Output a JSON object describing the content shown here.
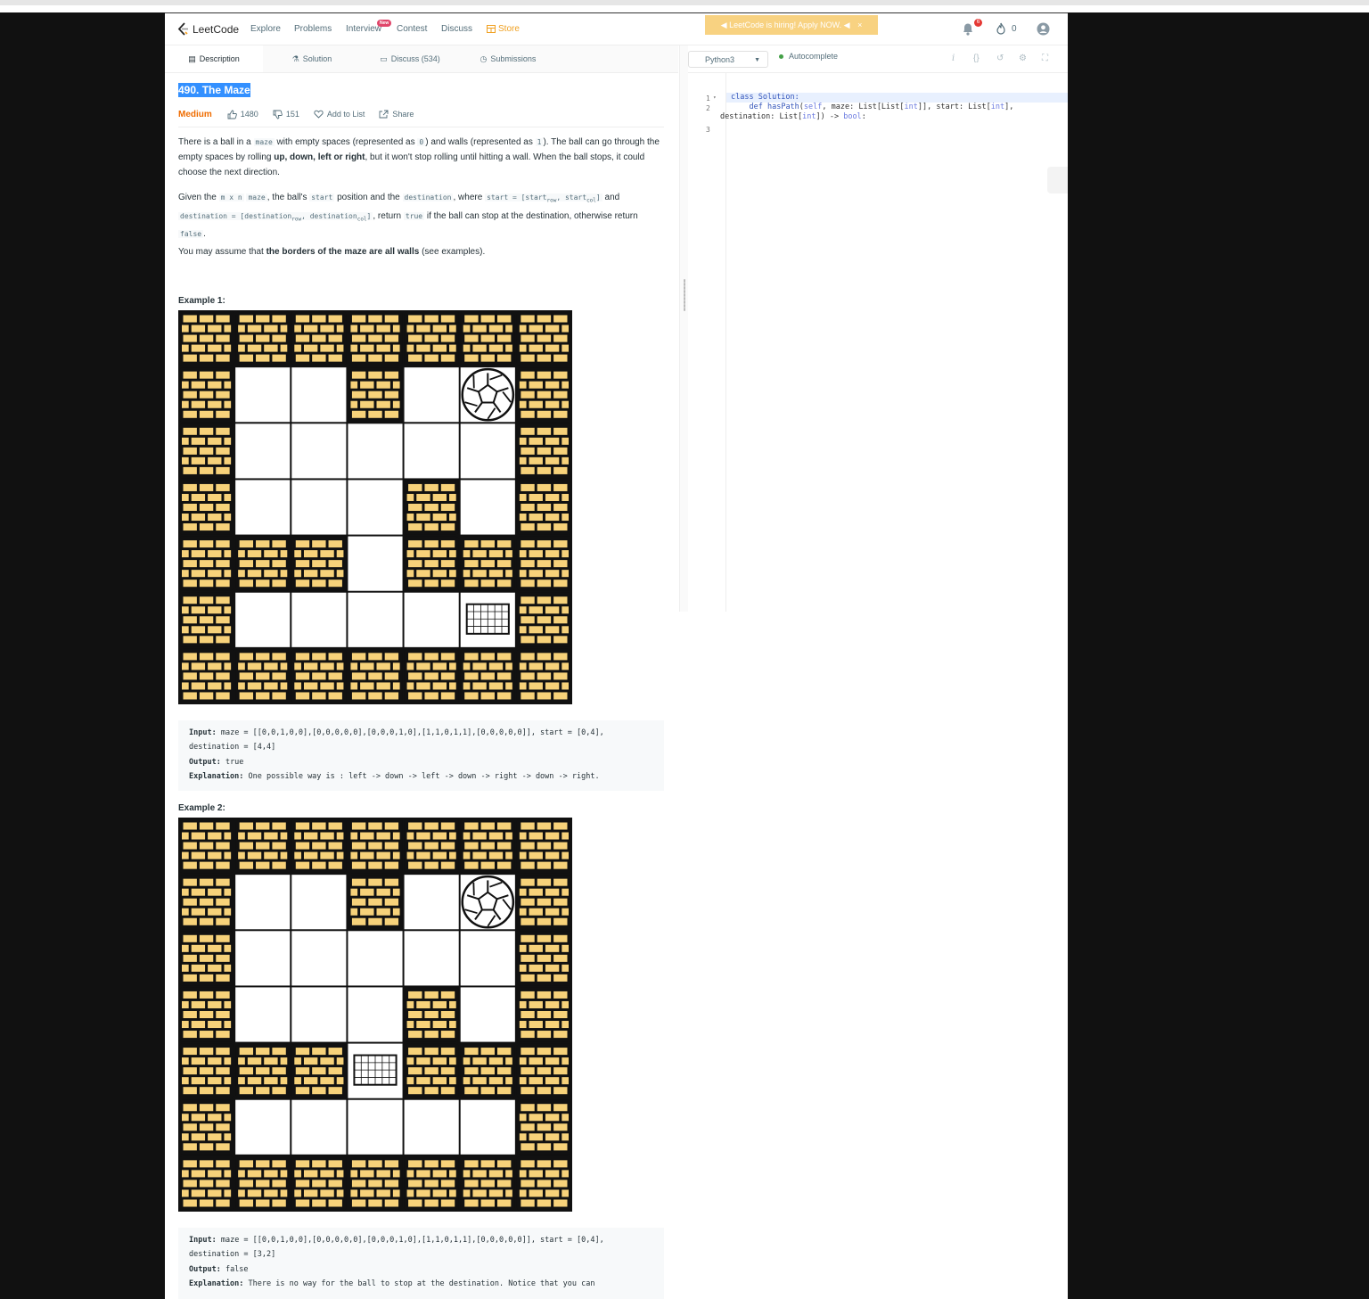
{
  "nav": {
    "logo": "LeetCode",
    "items": [
      "Explore",
      "Problems",
      "Interview",
      "Contest",
      "Discuss",
      "Store"
    ],
    "new_badge": "New",
    "hiring_banner": "LeetCode is hiring! Apply NOW.",
    "notif_count": "6",
    "fire_count": "0"
  },
  "tabs": {
    "description": "Description",
    "solution": "Solution",
    "discuss": "Discuss (534)",
    "submissions": "Submissions"
  },
  "problem": {
    "title": "490. The Maze",
    "difficulty": "Medium",
    "likes": "1480",
    "dislikes": "151",
    "add_to_list": "Add to List",
    "share": "Share",
    "example1_title": "Example 1:",
    "example2_title": "Example 2:"
  },
  "example1": {
    "input_label": "Input:",
    "input": " maze = [[0,0,1,0,0],[0,0,0,0,0],[0,0,0,1,0],[1,1,0,1,1],[0,0,0,0,0]], start = [0,4],",
    "input2": "destination = [4,4]",
    "output_label": "Output:",
    "output": " true",
    "explanation_label": "Explanation:",
    "explanation": " One possible way is : left -> down -> left -> down -> right -> down -> right."
  },
  "example2": {
    "input_label": "Input:",
    "input": " maze = [[0,0,1,0,0],[0,0,0,0,0],[0,0,0,1,0],[1,1,0,1,1],[0,0,0,0,0]], start = [0,4],",
    "input2": "destination = [3,2]",
    "output_label": "Output:",
    "output": " false",
    "explanation_label": "Explanation:",
    "explanation": " There is no way for the ball to stop at the destination. Notice that you can"
  },
  "editor": {
    "language": "Python3",
    "autocomplete": "Autocomplete",
    "line_numbers": [
      "1",
      "2",
      "3"
    ]
  },
  "mazes": {
    "example1": {
      "grid": [
        [
          0,
          0,
          1,
          0,
          0
        ],
        [
          0,
          0,
          0,
          0,
          0
        ],
        [
          0,
          0,
          0,
          1,
          0
        ],
        [
          1,
          1,
          0,
          1,
          1
        ],
        [
          0,
          0,
          0,
          0,
          0
        ]
      ],
      "ball": [
        0,
        4
      ],
      "goal": [
        4,
        4
      ]
    },
    "example2": {
      "grid": [
        [
          0,
          0,
          1,
          0,
          0
        ],
        [
          0,
          0,
          0,
          0,
          0
        ],
        [
          0,
          0,
          0,
          1,
          0
        ],
        [
          1,
          1,
          0,
          1,
          1
        ],
        [
          0,
          0,
          0,
          0,
          0
        ]
      ],
      "ball": [
        0,
        4
      ],
      "goal": [
        3,
        2
      ]
    }
  },
  "colors": {
    "brick": "#f7d27a",
    "accent": "#f0a020",
    "title_highlight": "#3390ff",
    "difficulty": "#ef6c00"
  }
}
